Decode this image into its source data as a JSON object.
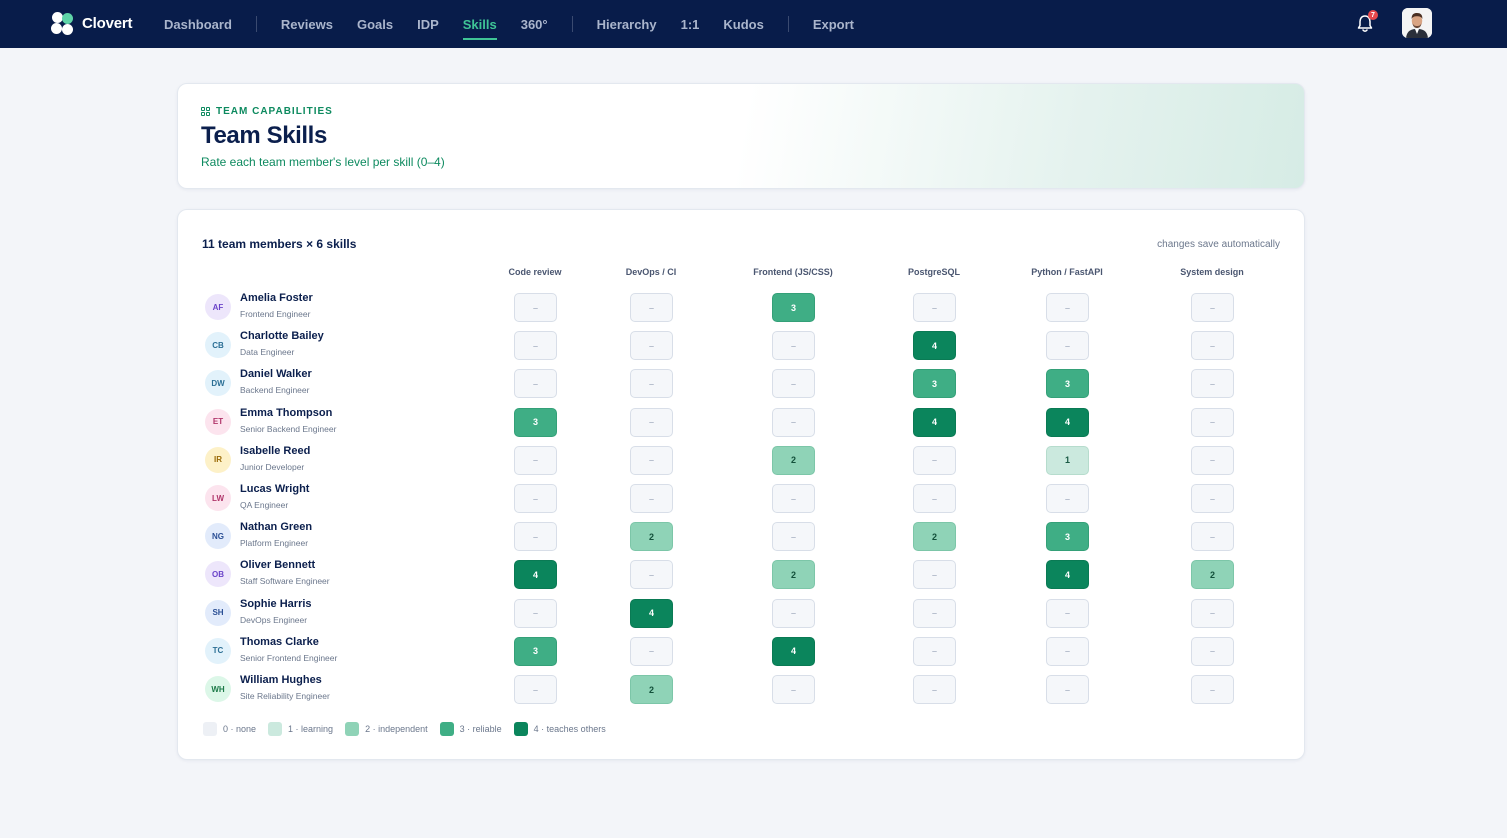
{
  "app": {
    "name": "Clovert"
  },
  "nav": [
    {
      "label": "Dashboard",
      "sep_after": true
    },
    {
      "label": "Reviews",
      "sep_after": false
    },
    {
      "label": "Goals",
      "sep_after": false
    },
    {
      "label": "IDP",
      "sep_after": false
    },
    {
      "label": "Skills",
      "active": true,
      "sep_after": false
    },
    {
      "label": "360°",
      "sep_after": true
    },
    {
      "label": "Hierarchy",
      "sep_after": false
    },
    {
      "label": "1:1",
      "sep_after": false
    },
    {
      "label": "Kudos",
      "sep_after": true
    },
    {
      "label": "Export",
      "sep_after": false
    }
  ],
  "notifications": {
    "count": "7",
    "icon": "bell-icon"
  },
  "header": {
    "eyebrow": "TEAM CAPABILITIES",
    "title": "Team Skills",
    "subtitle": "Rate each team member's level per skill (0–4)"
  },
  "matrix": {
    "summary": "11 team members × 6 skills",
    "autosave_note": "changes save automatically",
    "skills": [
      "Code review",
      "DevOps / CI",
      "Frontend (JS/CSS)",
      "PostgreSQL",
      "Python / FastAPI",
      "System design"
    ],
    "empty_symbol": "–",
    "members": [
      {
        "initials": "AF",
        "name": "Amelia Foster",
        "role": "Frontend Engineer",
        "avatar_bg": "#ede6fb",
        "avatar_fg": "#6b44c9",
        "levels": [
          0,
          0,
          3,
          0,
          0,
          0
        ]
      },
      {
        "initials": "CB",
        "name": "Charlotte Bailey",
        "role": "Data Engineer",
        "avatar_bg": "#e2f2fb",
        "avatar_fg": "#2b6f95",
        "levels": [
          0,
          0,
          0,
          4,
          0,
          0
        ]
      },
      {
        "initials": "DW",
        "name": "Daniel Walker",
        "role": "Backend Engineer",
        "avatar_bg": "#e2f2fb",
        "avatar_fg": "#2b6f95",
        "levels": [
          0,
          0,
          0,
          3,
          3,
          0
        ]
      },
      {
        "initials": "ET",
        "name": "Emma Thompson",
        "role": "Senior Backend Engineer",
        "avatar_bg": "#fce4ee",
        "avatar_fg": "#b0356a",
        "levels": [
          3,
          0,
          0,
          4,
          4,
          0
        ]
      },
      {
        "initials": "IR",
        "name": "Isabelle Reed",
        "role": "Junior Developer",
        "avatar_bg": "#fdf1c8",
        "avatar_fg": "#9a6a06",
        "levels": [
          0,
          0,
          2,
          0,
          1,
          0
        ]
      },
      {
        "initials": "LW",
        "name": "Lucas Wright",
        "role": "QA Engineer",
        "avatar_bg": "#fce4ee",
        "avatar_fg": "#b0356a",
        "levels": [
          0,
          0,
          0,
          0,
          0,
          0
        ]
      },
      {
        "initials": "NG",
        "name": "Nathan Green",
        "role": "Platform Engineer",
        "avatar_bg": "#e2ebfb",
        "avatar_fg": "#2b4f95",
        "levels": [
          0,
          2,
          0,
          2,
          3,
          0
        ]
      },
      {
        "initials": "OB",
        "name": "Oliver Bennett",
        "role": "Staff Software Engineer",
        "avatar_bg": "#ede6fb",
        "avatar_fg": "#6b44c9",
        "levels": [
          4,
          0,
          2,
          0,
          4,
          2
        ]
      },
      {
        "initials": "SH",
        "name": "Sophie Harris",
        "role": "DevOps Engineer",
        "avatar_bg": "#e2ebfb",
        "avatar_fg": "#2b4f95",
        "levels": [
          0,
          4,
          0,
          0,
          0,
          0
        ]
      },
      {
        "initials": "TC",
        "name": "Thomas Clarke",
        "role": "Senior Frontend Engineer",
        "avatar_bg": "#e2f2fb",
        "avatar_fg": "#2b6f95",
        "levels": [
          3,
          0,
          4,
          0,
          0,
          0
        ]
      },
      {
        "initials": "WH",
        "name": "William Hughes",
        "role": "Site Reliability Engineer",
        "avatar_bg": "#dcf7e8",
        "avatar_fg": "#1c7a48",
        "levels": [
          0,
          2,
          0,
          0,
          0,
          0
        ]
      }
    ]
  },
  "legend": [
    {
      "label": "0 · none",
      "color": "#edf0f5"
    },
    {
      "label": "1 · learning",
      "color": "#cbe9de"
    },
    {
      "label": "2 · independent",
      "color": "#8fd3b7"
    },
    {
      "label": "3 · reliable",
      "color": "#3fae85"
    },
    {
      "label": "4 · teaches others",
      "color": "#0b855c"
    }
  ]
}
